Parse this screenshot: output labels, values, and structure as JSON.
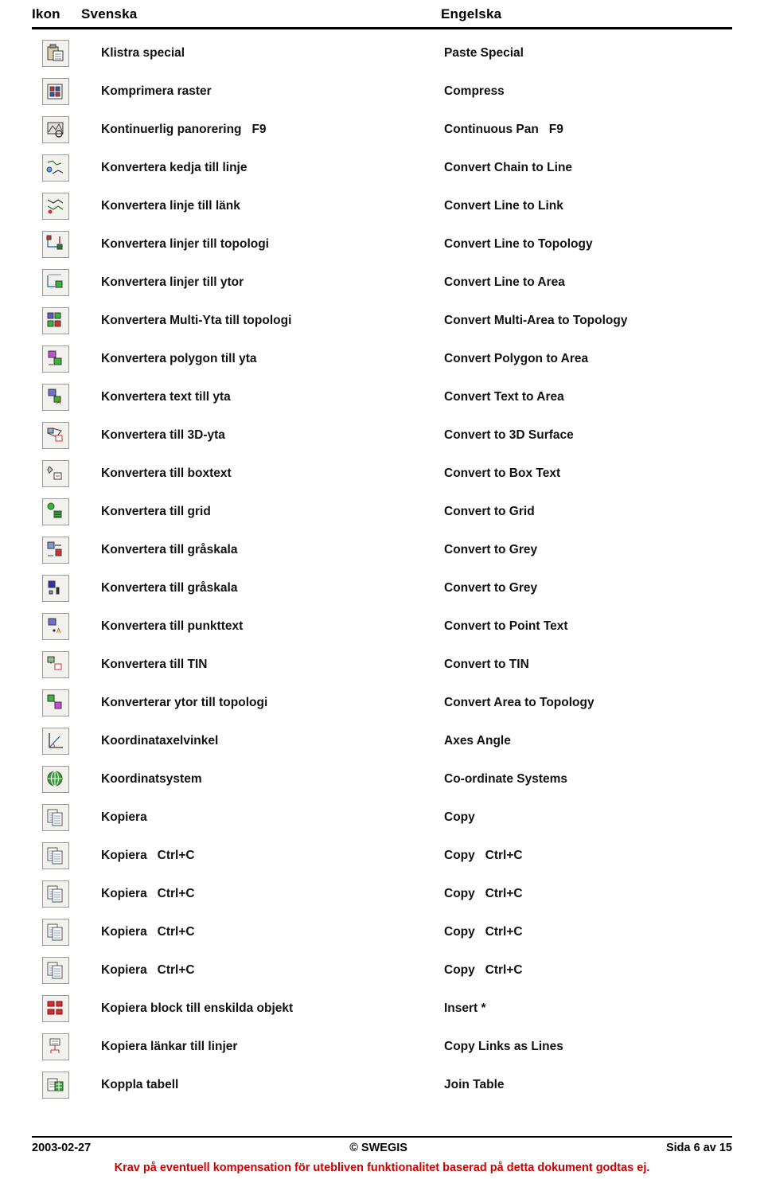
{
  "header": {
    "col_icon": "Ikon",
    "col_swedish": "Svenska",
    "col_english": "Engelska"
  },
  "rows": [
    {
      "icon": "paste-special-icon",
      "sv": "Klistra special",
      "en": "Paste Special"
    },
    {
      "icon": "compress-raster-icon",
      "sv": "Komprimera raster",
      "en": "Compress"
    },
    {
      "icon": "continuous-pan-icon",
      "sv": "Kontinuerlig panorering   F9",
      "en": "Continuous Pan   F9"
    },
    {
      "icon": "convert-chain-to-line-icon",
      "sv": "Konvertera kedja till linje",
      "en": "Convert Chain to Line"
    },
    {
      "icon": "convert-line-to-link-icon",
      "sv": "Konvertera linje till länk",
      "en": "Convert Line to Link"
    },
    {
      "icon": "convert-line-to-topology-icon",
      "sv": "Konvertera linjer till topologi",
      "en": "Convert Line to Topology"
    },
    {
      "icon": "convert-line-to-area-icon",
      "sv": "Konvertera linjer till ytor",
      "en": "Convert Line to Area"
    },
    {
      "icon": "convert-multiarea-to-topology-icon",
      "sv": "Konvertera Multi-Yta till topologi",
      "en": "Convert Multi-Area to Topology"
    },
    {
      "icon": "convert-polygon-to-area-icon",
      "sv": "Konvertera polygon till yta",
      "en": "Convert Polygon to Area"
    },
    {
      "icon": "convert-text-to-area-icon",
      "sv": "Konvertera text till yta",
      "en": "Convert Text to Area"
    },
    {
      "icon": "convert-to-3d-surface-icon",
      "sv": "Konvertera till 3D-yta",
      "en": "Convert to 3D Surface"
    },
    {
      "icon": "convert-to-box-text-icon",
      "sv": "Konvertera till boxtext",
      "en": "Convert to Box Text"
    },
    {
      "icon": "convert-to-grid-icon",
      "sv": "Konvertera till grid",
      "en": "Convert to Grid"
    },
    {
      "icon": "convert-to-grey-icon",
      "sv": "Konvertera till gråskala",
      "en": "Convert to Grey"
    },
    {
      "icon": "convert-to-grey-alt-icon",
      "sv": "Konvertera till gråskala",
      "en": "Convert to Grey"
    },
    {
      "icon": "convert-to-point-text-icon",
      "sv": "Konvertera till punkttext",
      "en": "Convert to Point Text"
    },
    {
      "icon": "convert-to-tin-icon",
      "sv": "Konvertera till TIN",
      "en": "Convert to TIN"
    },
    {
      "icon": "convert-area-to-topology-icon",
      "sv": "Konverterar ytor till topologi",
      "en": "Convert Area to Topology"
    },
    {
      "icon": "axes-angle-icon",
      "sv": "Koordinataxelvinkel",
      "en": "Axes Angle"
    },
    {
      "icon": "coordinate-systems-icon",
      "sv": "Koordinatsystem",
      "en": "Co-ordinate Systems"
    },
    {
      "icon": "copy-icon",
      "sv": "Kopiera",
      "en": "Copy"
    },
    {
      "icon": "copy-icon-2",
      "sv": "Kopiera   Ctrl+C",
      "en": "Copy   Ctrl+C"
    },
    {
      "icon": "copy-icon-3",
      "sv": "Kopiera   Ctrl+C",
      "en": "Copy   Ctrl+C"
    },
    {
      "icon": "copy-icon-4",
      "sv": "Kopiera   Ctrl+C",
      "en": "Copy   Ctrl+C"
    },
    {
      "icon": "copy-icon-5",
      "sv": "Kopiera   Ctrl+C",
      "en": "Copy   Ctrl+C"
    },
    {
      "icon": "copy-block-to-objects-icon",
      "sv": "Kopiera block till enskilda objekt",
      "en": "Insert *"
    },
    {
      "icon": "copy-links-as-lines-icon",
      "sv": "Kopiera länkar till linjer",
      "en": "Copy Links as Lines"
    },
    {
      "icon": "join-table-icon",
      "sv": "Koppla tabell",
      "en": "Join Table"
    }
  ],
  "footer": {
    "date": "2003-02-27",
    "copyright": "© SWEGIS",
    "page": "Sida 6 av 15",
    "note": "Krav på eventuell kompensation för utebliven funktionalitet baserad på detta dokument godtas ej."
  },
  "colors": {
    "note_red": "#cc0000",
    "icon_bg": "#f2f1ee",
    "icon_border": "#9a9a9a"
  }
}
